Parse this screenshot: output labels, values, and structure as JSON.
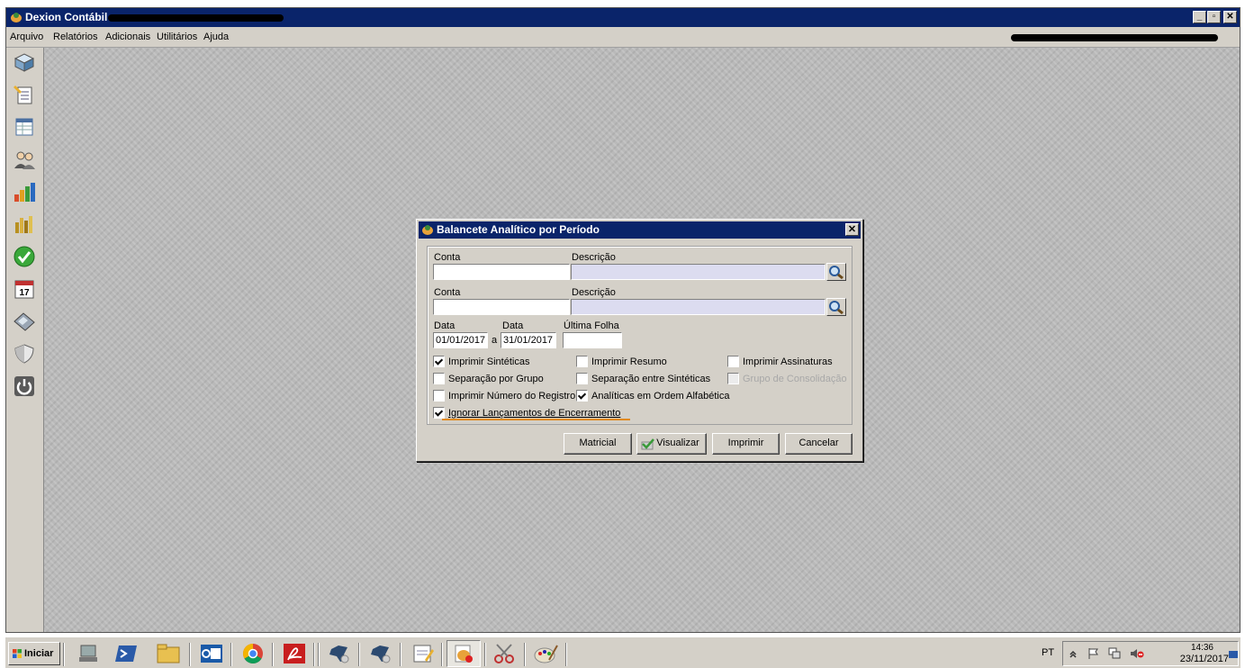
{
  "window": {
    "title": "Dexion Contábil -",
    "controls": [
      "_",
      "▫",
      "✕"
    ]
  },
  "menubar": {
    "items": [
      "Arquivo",
      "Relatórios",
      "Adicionais",
      "Utilitários",
      "Ajuda"
    ]
  },
  "sidebar": {
    "icons": [
      "cube-icon",
      "notes-icon",
      "spreadsheet-icon",
      "people-icon",
      "bar-chart-icon",
      "bar-chart-gold-icon",
      "checkmark-icon",
      "calendar-icon",
      "calculator-icon",
      "shield-icon",
      "power-icon"
    ],
    "calendar_day": "17"
  },
  "dialog": {
    "title": "Balancete Analítico por Período",
    "close_label": "✕",
    "conta_label": "Conta",
    "descricao_label": "Descrição",
    "conta1_value": "",
    "descricao1_value": "",
    "conta2_value": "",
    "descricao2_value": "",
    "data_label": "Data",
    "data_ini": "01/01/2017",
    "sep_a": "a",
    "data_fim": "31/01/2017",
    "ultima_folha_label": "Última Folha",
    "ultima_folha_value": "",
    "checkboxes": [
      {
        "label": "Imprimir Sintéticas",
        "checked": true,
        "enabled": true
      },
      {
        "label": "Imprimir Resumo",
        "checked": false,
        "enabled": true
      },
      {
        "label": "Imprimir Assinaturas",
        "checked": false,
        "enabled": true
      },
      {
        "label": "Separação por Grupo",
        "checked": false,
        "enabled": true
      },
      {
        "label": "Separação entre Sintéticas",
        "checked": false,
        "enabled": true
      },
      {
        "label": "Grupo de Consolidação",
        "checked": false,
        "enabled": false
      },
      {
        "label": "Imprimir Número do Registro",
        "checked": false,
        "enabled": true
      },
      {
        "label": "Analíticas em Ordem Alfabética",
        "checked": true,
        "enabled": true
      },
      {
        "label": "Ignorar Lançamentos de Encerramento",
        "checked": true,
        "enabled": true,
        "focused": true
      }
    ],
    "buttons": {
      "matricial": "Matricial",
      "visualizar": "Visualizar",
      "imprimir": "Imprimir",
      "cancelar": "Cancelar"
    }
  },
  "taskbar": {
    "start_label": "Iniciar",
    "apps": [
      "network-icon",
      "powershell-icon",
      "folder-icon",
      "outlook-icon",
      "chrome-icon",
      "acrobat-icon",
      "dexion-icon",
      "dexion-icon",
      "notes-icon",
      "dexion-active-icon",
      "scissors-icon",
      "paint-icon"
    ],
    "language": "PT",
    "time": "14:36",
    "date": "23/11/2017"
  },
  "colors": {
    "titlebar": "#0a246a",
    "face": "#d4d0c8",
    "focus_underline": "#e08a1a"
  }
}
